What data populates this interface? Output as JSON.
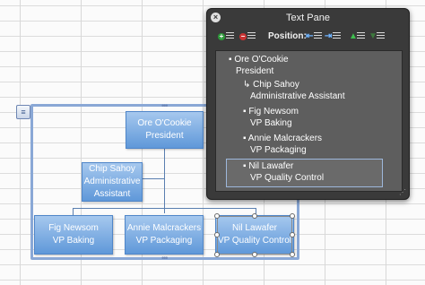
{
  "pane": {
    "title": "Text Pane",
    "position_label": "Position:",
    "close_icon": "close-icon",
    "lines": [
      {
        "bullet": "▪",
        "text": "Ore O'Cookie"
      },
      {
        "bullet": "",
        "text": "President"
      },
      {
        "bullet": "↳",
        "text": "Chip Sahoy"
      },
      {
        "bullet": "",
        "text": "Administrative Assistant"
      },
      {
        "bullet": "▪",
        "text": "Fig Newsom"
      },
      {
        "bullet": "",
        "text": "VP Baking"
      },
      {
        "bullet": "▪",
        "text": "Annie Malcrackers"
      },
      {
        "bullet": "",
        "text": "VP Packaging"
      },
      {
        "bullet": "▪",
        "text": "Nil Lawafer"
      },
      {
        "bullet": "",
        "text": "VP Quality Control"
      }
    ],
    "selected_line_index": 8
  },
  "chart": {
    "president": {
      "name": "Ore O'Cookie",
      "role": "President"
    },
    "assistant": {
      "name": "Chip Sahoy",
      "role_line1": "Administrative",
      "role_line2": "Assistant"
    },
    "vp1": {
      "name": "Fig Newsom",
      "role": "VP Baking"
    },
    "vp2": {
      "name": "Annie Malcrackers",
      "role": "VP Packaging"
    },
    "vp3": {
      "name": "Nil Lawafer",
      "role": "VP Quality Control"
    }
  },
  "colors": {
    "node_top": "#a6c8ee",
    "node_bottom": "#5f98d9",
    "pane_bg": "#3a3a3a",
    "selection": "#9db7db",
    "promote_dot": "#2e9a3a",
    "demote_dot": "#c83232"
  }
}
